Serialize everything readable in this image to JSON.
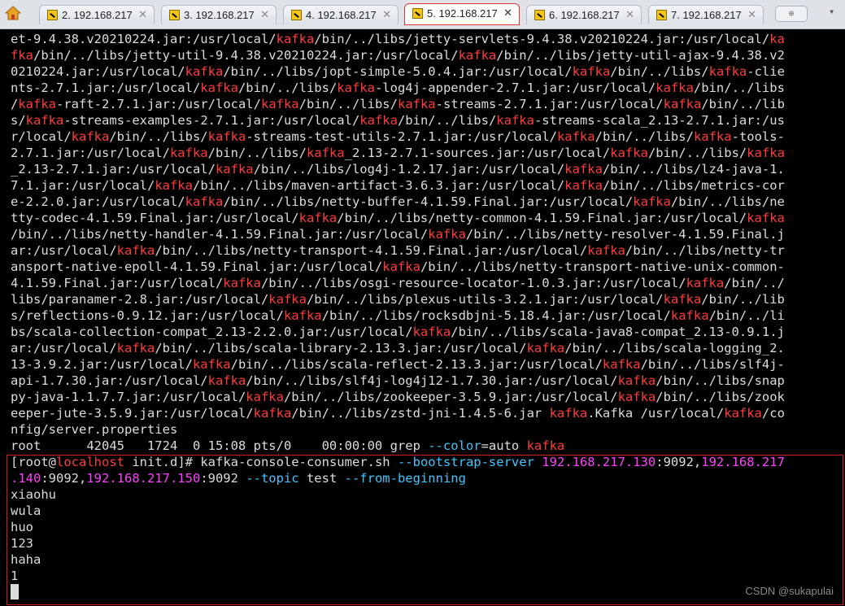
{
  "tabs": [
    {
      "label": "2. 192.168.217"
    },
    {
      "label": "3. 192.168.217"
    },
    {
      "label": "4. 192.168.217"
    },
    {
      "label": "5. 192.168.217"
    },
    {
      "label": "6. 192.168.217"
    },
    {
      "label": "7. 192.168.217"
    }
  ],
  "active_tab_index": 3,
  "close_glyph": "✕",
  "new_tab_glyph": "⊕",
  "menu_glyph": "▾",
  "colors": {
    "keyword": "#ff3b3b",
    "ip": "#ff40ff",
    "option": "#3fc6ff",
    "text": "#dcdcdc",
    "background": "#000000",
    "highlight_border": "#d01f1f"
  },
  "terminal_lines": [
    [
      [
        "et-9.4.38.v20210224.jar:/usr/local/",
        ""
      ],
      [
        "kafka",
        "k"
      ],
      [
        "/bin/../libs/jetty-servlets-9.4.38.v20210224.jar:/usr/local/",
        ""
      ],
      [
        "ka",
        "k"
      ]
    ],
    [
      [
        "fka",
        "k"
      ],
      [
        "/bin/../libs/jetty-util-9.4.38.v20210224.jar:/usr/local/",
        ""
      ],
      [
        "kafka",
        "k"
      ],
      [
        "/bin/../libs/jetty-util-ajax-9.4.38.v2",
        ""
      ]
    ],
    [
      [
        "0210224.jar:/usr/local/",
        ""
      ],
      [
        "kafka",
        "k"
      ],
      [
        "/bin/../libs/jopt-simple-5.0.4.jar:/usr/local/",
        ""
      ],
      [
        "kafka",
        "k"
      ],
      [
        "/bin/../libs/",
        ""
      ],
      [
        "kafka",
        "k"
      ],
      [
        "-clie",
        ""
      ]
    ],
    [
      [
        "nts-2.7.1.jar:/usr/local/",
        ""
      ],
      [
        "kafka",
        "k"
      ],
      [
        "/bin/../libs/",
        ""
      ],
      [
        "kafka",
        "k"
      ],
      [
        "-log4j-appender-2.7.1.jar:/usr/local/",
        ""
      ],
      [
        "kafka",
        "k"
      ],
      [
        "/bin/../libs",
        ""
      ]
    ],
    [
      [
        "/",
        ""
      ],
      [
        "kafka",
        "k"
      ],
      [
        "-raft-2.7.1.jar:/usr/local/",
        ""
      ],
      [
        "kafka",
        "k"
      ],
      [
        "/bin/../libs/",
        ""
      ],
      [
        "kafka",
        "k"
      ],
      [
        "-streams-2.7.1.jar:/usr/local/",
        ""
      ],
      [
        "kafka",
        "k"
      ],
      [
        "/bin/../lib",
        ""
      ]
    ],
    [
      [
        "s/",
        ""
      ],
      [
        "kafka",
        "k"
      ],
      [
        "-streams-examples-2.7.1.jar:/usr/local/",
        ""
      ],
      [
        "kafka",
        "k"
      ],
      [
        "/bin/../libs/",
        ""
      ],
      [
        "kafka",
        "k"
      ],
      [
        "-streams-scala_2.13-2.7.1.jar:/us",
        ""
      ]
    ],
    [
      [
        "r/local/",
        ""
      ],
      [
        "kafka",
        "k"
      ],
      [
        "/bin/../libs/",
        ""
      ],
      [
        "kafka",
        "k"
      ],
      [
        "-streams-test-utils-2.7.1.jar:/usr/local/",
        ""
      ],
      [
        "kafka",
        "k"
      ],
      [
        "/bin/../libs/",
        ""
      ],
      [
        "kafka",
        "k"
      ],
      [
        "-tools-",
        ""
      ]
    ],
    [
      [
        "2.7.1.jar:/usr/local/",
        ""
      ],
      [
        "kafka",
        "k"
      ],
      [
        "/bin/../libs/",
        ""
      ],
      [
        "kafka",
        "k"
      ],
      [
        "_2.13-2.7.1-sources.jar:/usr/local/",
        ""
      ],
      [
        "kafka",
        "k"
      ],
      [
        "/bin/../libs/",
        ""
      ],
      [
        "kafka",
        "k"
      ]
    ],
    [
      [
        "_2.13-2.7.1.jar:/usr/local/",
        ""
      ],
      [
        "kafka",
        "k"
      ],
      [
        "/bin/../libs/log4j-1.2.17.jar:/usr/local/",
        ""
      ],
      [
        "kafka",
        "k"
      ],
      [
        "/bin/../libs/lz4-java-1.",
        ""
      ]
    ],
    [
      [
        "7.1.jar:/usr/local/",
        ""
      ],
      [
        "kafka",
        "k"
      ],
      [
        "/bin/../libs/maven-artifact-3.6.3.jar:/usr/local/",
        ""
      ],
      [
        "kafka",
        "k"
      ],
      [
        "/bin/../libs/metrics-cor",
        ""
      ]
    ],
    [
      [
        "e-2.2.0.jar:/usr/local/",
        ""
      ],
      [
        "kafka",
        "k"
      ],
      [
        "/bin/../libs/netty-buffer-4.1.59.Final.jar:/usr/local/",
        ""
      ],
      [
        "kafka",
        "k"
      ],
      [
        "/bin/../libs/ne",
        ""
      ]
    ],
    [
      [
        "tty-codec-4.1.59.Final.jar:/usr/local/",
        ""
      ],
      [
        "kafka",
        "k"
      ],
      [
        "/bin/../libs/netty-common-4.1.59.Final.jar:/usr/local/",
        ""
      ],
      [
        "kafka",
        "k"
      ]
    ],
    [
      [
        "/bin/../libs/netty-handler-4.1.59.Final.jar:/usr/local/",
        ""
      ],
      [
        "kafka",
        "k"
      ],
      [
        "/bin/../libs/netty-resolver-4.1.59.Final.j",
        ""
      ]
    ],
    [
      [
        "ar:/usr/local/",
        ""
      ],
      [
        "kafka",
        "k"
      ],
      [
        "/bin/../libs/netty-transport-4.1.59.Final.jar:/usr/local/",
        ""
      ],
      [
        "kafka",
        "k"
      ],
      [
        "/bin/../libs/netty-tr",
        ""
      ]
    ],
    [
      [
        "ansport-native-epoll-4.1.59.Final.jar:/usr/local/",
        ""
      ],
      [
        "kafka",
        "k"
      ],
      [
        "/bin/../libs/netty-transport-native-unix-common-",
        ""
      ]
    ],
    [
      [
        "4.1.59.Final.jar:/usr/local/",
        ""
      ],
      [
        "kafka",
        "k"
      ],
      [
        "/bin/../libs/osgi-resource-locator-1.0.3.jar:/usr/local/",
        ""
      ],
      [
        "kafka",
        "k"
      ],
      [
        "/bin/../",
        ""
      ]
    ],
    [
      [
        "libs/paranamer-2.8.jar:/usr/local/",
        ""
      ],
      [
        "kafka",
        "k"
      ],
      [
        "/bin/../libs/plexus-utils-3.2.1.jar:/usr/local/",
        ""
      ],
      [
        "kafka",
        "k"
      ],
      [
        "/bin/../lib",
        ""
      ]
    ],
    [
      [
        "s/reflections-0.9.12.jar:/usr/local/",
        ""
      ],
      [
        "kafka",
        "k"
      ],
      [
        "/bin/../libs/rocksdbjni-5.18.4.jar:/usr/local/",
        ""
      ],
      [
        "kafka",
        "k"
      ],
      [
        "/bin/../li",
        ""
      ]
    ],
    [
      [
        "bs/scala-collection-compat_2.13-2.2.0.jar:/usr/local/",
        ""
      ],
      [
        "kafka",
        "k"
      ],
      [
        "/bin/../libs/scala-java8-compat_2.13-0.9.1.j",
        ""
      ]
    ],
    [
      [
        "ar:/usr/local/",
        ""
      ],
      [
        "kafka",
        "k"
      ],
      [
        "/bin/../libs/scala-library-2.13.3.jar:/usr/local/",
        ""
      ],
      [
        "kafka",
        "k"
      ],
      [
        "/bin/../libs/scala-logging_2.",
        ""
      ]
    ],
    [
      [
        "13-3.9.2.jar:/usr/local/",
        ""
      ],
      [
        "kafka",
        "k"
      ],
      [
        "/bin/../libs/scala-reflect-2.13.3.jar:/usr/local/",
        ""
      ],
      [
        "kafka",
        "k"
      ],
      [
        "/bin/../libs/slf4j-",
        ""
      ]
    ],
    [
      [
        "api-1.7.30.jar:/usr/local/",
        ""
      ],
      [
        "kafka",
        "k"
      ],
      [
        "/bin/../libs/slf4j-log4j12-1.7.30.jar:/usr/local/",
        ""
      ],
      [
        "kafka",
        "k"
      ],
      [
        "/bin/../libs/snap",
        ""
      ]
    ],
    [
      [
        "py-java-1.1.7.7.jar:/usr/local/",
        ""
      ],
      [
        "kafka",
        "k"
      ],
      [
        "/bin/../libs/zookeeper-3.5.9.jar:/usr/local/",
        ""
      ],
      [
        "kafka",
        "k"
      ],
      [
        "/bin/../libs/zook",
        ""
      ]
    ],
    [
      [
        "eeper-jute-3.5.9.jar:/usr/local/",
        ""
      ],
      [
        "kafka",
        "k"
      ],
      [
        "/bin/../libs/zstd-jni-1.4.5-6.jar ",
        ""
      ],
      [
        "kafka",
        "k"
      ],
      [
        ".Kafka /usr/local/",
        ""
      ],
      [
        "kafka",
        "k"
      ],
      [
        "/co",
        ""
      ]
    ],
    [
      [
        "nfig/server.properties",
        ""
      ]
    ],
    [
      [
        "root      42045   1724  0 15:08 pts/0    00:00:00 grep ",
        ""
      ],
      [
        "--color",
        "c"
      ],
      [
        "=auto ",
        ""
      ],
      [
        "kafka",
        "k"
      ]
    ],
    [
      [
        "[root@",
        ""
      ],
      [
        "localhost",
        "k"
      ],
      [
        " init.d]# kafka-console-consumer.sh ",
        ""
      ],
      [
        "--bootstrap-server",
        "c"
      ],
      [
        " ",
        ""
      ],
      [
        "192.168.217.130",
        "p"
      ],
      [
        ":9092,",
        ""
      ],
      [
        "192.168.217",
        "p"
      ]
    ],
    [
      [
        ".140",
        "p"
      ],
      [
        ":9092,",
        ""
      ],
      [
        "192.168.217.150",
        "p"
      ],
      [
        ":9092 ",
        ""
      ],
      [
        "--topic",
        "c"
      ],
      [
        " test ",
        ""
      ],
      [
        "--from-beginning",
        "c"
      ]
    ],
    [
      [
        "xiaohu",
        ""
      ]
    ],
    [
      [
        "wula",
        ""
      ]
    ],
    [
      [
        "huo",
        ""
      ]
    ],
    [
      [
        "123",
        ""
      ]
    ],
    [
      [
        "haha",
        ""
      ]
    ],
    [
      [
        "1",
        ""
      ]
    ]
  ],
  "watermark": "CSDN @sukapulai"
}
